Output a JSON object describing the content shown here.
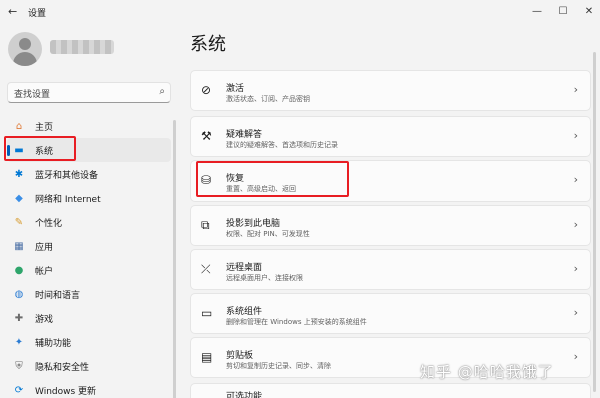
{
  "window": {
    "title": "设置",
    "back_icon": "←",
    "minimize_icon": "—",
    "maximize_icon": "☐",
    "close_icon": "✕"
  },
  "search": {
    "placeholder": "查找设置",
    "icon": "⌕"
  },
  "nav": [
    {
      "name": "home",
      "label": "主页",
      "icon": "⌂",
      "color": "#e07b39"
    },
    {
      "name": "system",
      "label": "系统",
      "icon": "▬",
      "color": "#0078d4",
      "active": true
    },
    {
      "name": "bluetooth",
      "label": "蓝牙和其他设备",
      "icon": "✱",
      "color": "#0078d4"
    },
    {
      "name": "network",
      "label": "网络和 Internet",
      "icon": "◆",
      "color": "#3a8ee6"
    },
    {
      "name": "personalization",
      "label": "个性化",
      "icon": "✎",
      "color": "#d69a2d"
    },
    {
      "name": "apps",
      "label": "应用",
      "icon": "▦",
      "color": "#4a6fa5"
    },
    {
      "name": "accounts",
      "label": "帐户",
      "icon": "●",
      "color": "#2ea56b"
    },
    {
      "name": "time-language",
      "label": "时间和语言",
      "icon": "◍",
      "color": "#2b7cd3"
    },
    {
      "name": "gaming",
      "label": "游戏",
      "icon": "✚",
      "color": "#6b6b6b"
    },
    {
      "name": "accessibility",
      "label": "辅助功能",
      "icon": "✦",
      "color": "#2b7cd3"
    },
    {
      "name": "privacy",
      "label": "隐私和安全性",
      "icon": "⛨",
      "color": "#6b6b6b"
    },
    {
      "name": "windows-update",
      "label": "Windows 更新",
      "icon": "⟳",
      "color": "#0078d4"
    }
  ],
  "page": {
    "title": "系统"
  },
  "cards": [
    {
      "name": "activation",
      "title": "激活",
      "subtitle": "激活状态、订阅、产品密钥",
      "icon": "⊘"
    },
    {
      "name": "troubleshoot",
      "title": "疑难解答",
      "subtitle": "建议的疑难解答、首选项和历史记录",
      "icon": "⚒"
    },
    {
      "name": "recovery",
      "title": "恢复",
      "subtitle": "重置、高级启动、返回",
      "icon": "⛁"
    },
    {
      "name": "projecting",
      "title": "投影到此电脑",
      "subtitle": "权限、配对 PIN、可发现性",
      "icon": "⧉"
    },
    {
      "name": "remote-desktop",
      "title": "远程桌面",
      "subtitle": "远程桌面用户、连接权限",
      "icon": "⤫"
    },
    {
      "name": "system-components",
      "title": "系统组件",
      "subtitle": "删除和管理在 Windows 上预安装的系统组件",
      "icon": "▭"
    },
    {
      "name": "clipboard",
      "title": "剪贴板",
      "subtitle": "剪切和复制历史记录、同步、清除",
      "icon": "▤"
    },
    {
      "name": "optional-features",
      "title": "可选功能",
      "subtitle": "",
      "icon": ""
    }
  ],
  "chevron": "›",
  "watermark": "知乎 @哈哈我饿了"
}
